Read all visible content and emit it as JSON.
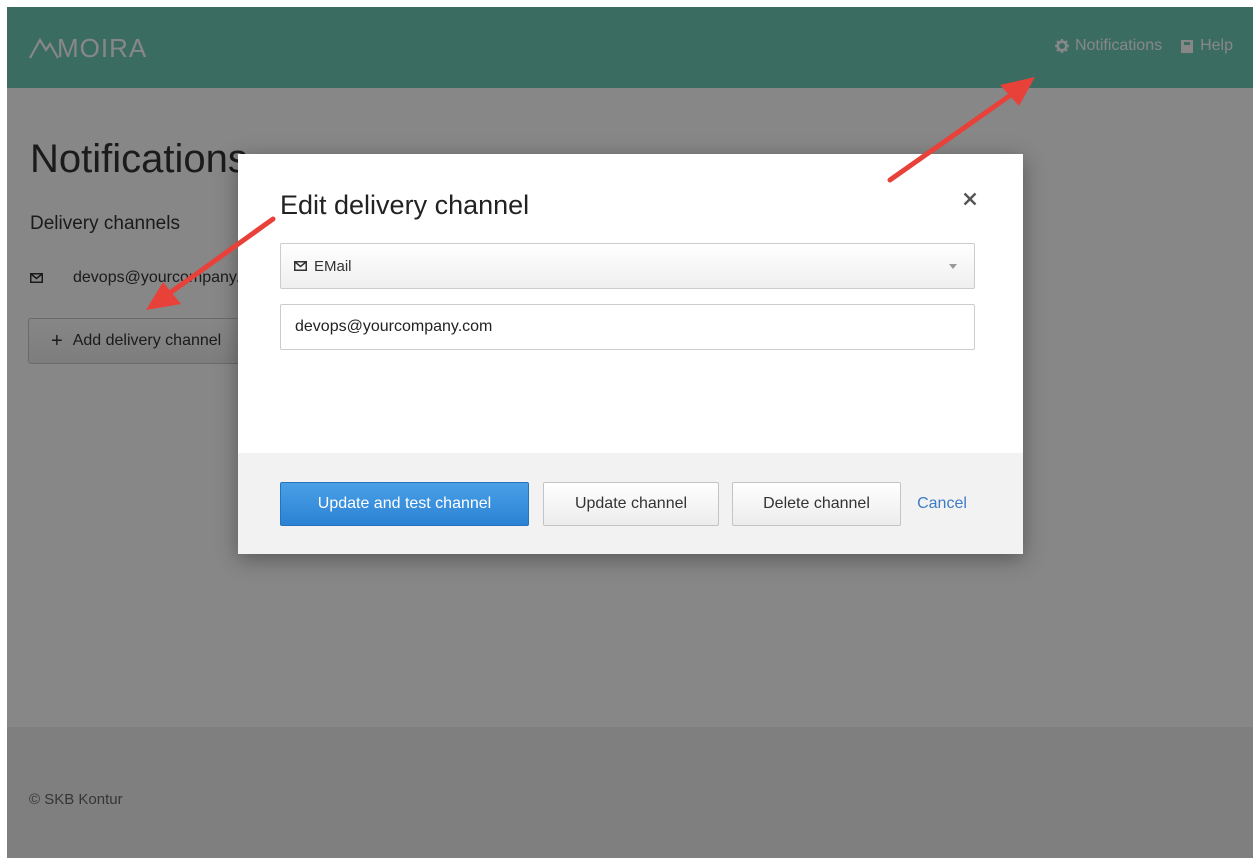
{
  "app": {
    "logo_text": "MOIRA"
  },
  "header": {
    "nav": [
      {
        "label": "Notifications",
        "icon": "gear-icon"
      },
      {
        "label": "Help",
        "icon": "book-icon"
      }
    ]
  },
  "page": {
    "title": "Notifications",
    "section_title": "Delivery channels",
    "channels": [
      {
        "icon": "mail-icon",
        "value": "devops@yourcompany.com"
      }
    ],
    "add_button_label": "Add delivery channel"
  },
  "footer": {
    "copyright": "© SKB Kontur"
  },
  "modal": {
    "title": "Edit delivery channel",
    "channel_type": {
      "selected": "EMail",
      "icon": "mail-icon"
    },
    "address_value": "devops@yourcompany.com",
    "buttons": {
      "update_and_test": "Update and test channel",
      "update": "Update channel",
      "delete": "Delete channel",
      "cancel": "Cancel"
    }
  },
  "colors": {
    "header_bg": "#6fcdb9",
    "primary_button": "#2b82d4",
    "link": "#3d7bc7",
    "annotation_arrow": "#e8413a"
  }
}
